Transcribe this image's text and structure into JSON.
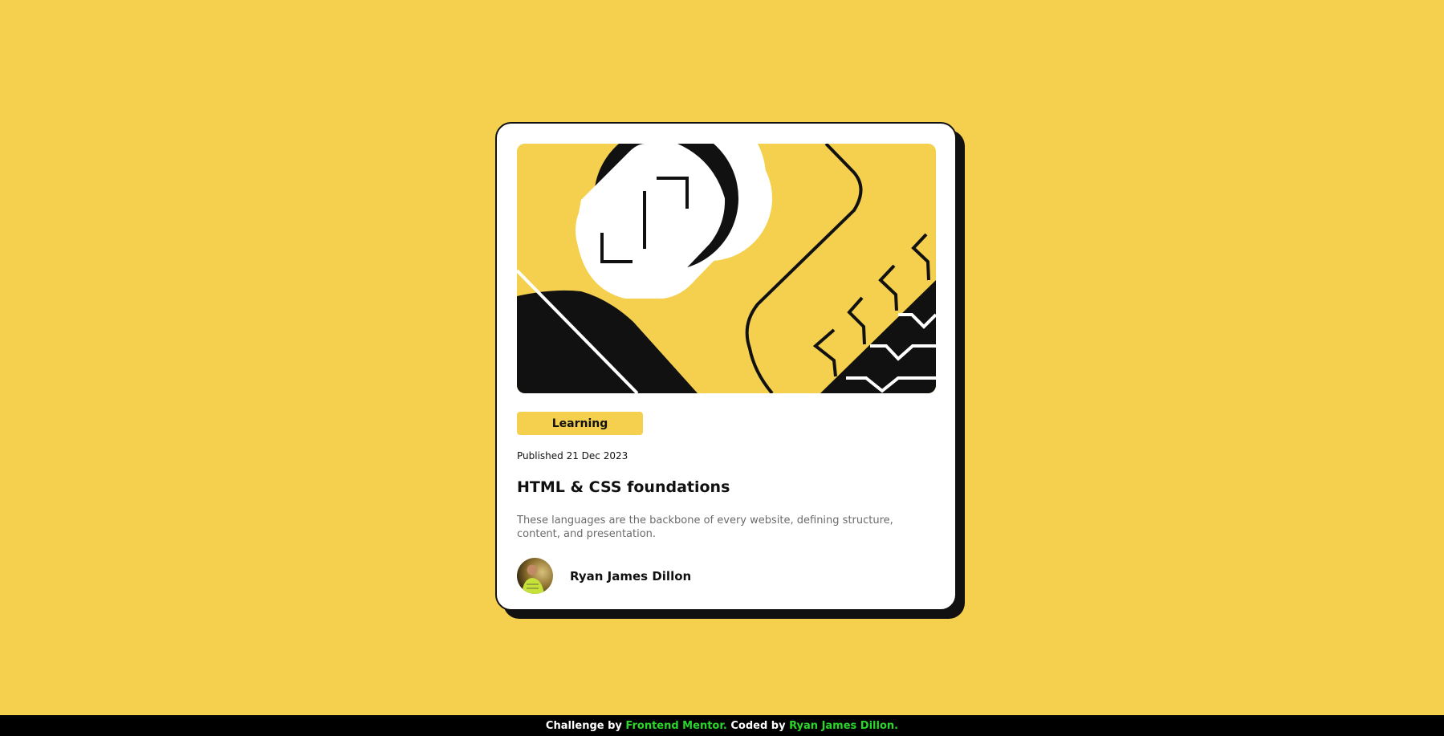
{
  "colors": {
    "page_background": "#f4d04e",
    "card_background": "#ffffff",
    "ink": "#111111",
    "muted_text": "#6b6b6b",
    "footer_background": "#000000",
    "footer_link": "#2bd62b"
  },
  "card": {
    "hero_image": "abstract-illustration",
    "category": "Learning",
    "published": "Published 21 Dec 2023",
    "title": "HTML & CSS foundations",
    "description": "These languages are the backbone of every website, defining structure, content, and presentation.",
    "author": {
      "avatar": "author-avatar-photo",
      "name": "Ryan James Dillon"
    }
  },
  "footer": {
    "prefix": "Challenge by ",
    "challenge_link": "Frontend Mentor.",
    "middle": " Coded by ",
    "author_link": "Ryan James Dillon."
  }
}
